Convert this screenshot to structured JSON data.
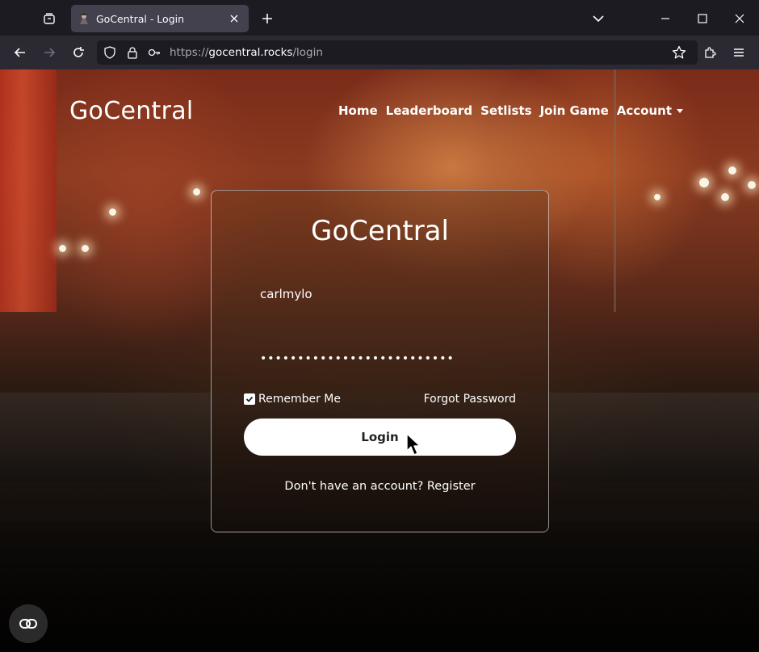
{
  "browser": {
    "tab": {
      "title": "GoCentral - Login",
      "favicon": "guitarist-favicon-icon"
    },
    "url": {
      "prefix": "https://",
      "host": "gocentral.rocks",
      "path": "/login"
    },
    "icons": {
      "tab_list": "tab-list-icon",
      "new_tab": "plus-icon",
      "list_all": "chevron-down-icon",
      "minimize": "minimize-icon",
      "maximize": "maximize-icon",
      "close": "close-icon",
      "back": "arrow-left-icon",
      "forward": "arrow-right-icon",
      "reload": "reload-icon",
      "shield": "shield-icon",
      "lock": "lock-icon",
      "key": "key-icon",
      "bookmark": "star-icon",
      "extensions": "puzzle-icon",
      "menu": "hamburger-icon"
    }
  },
  "header": {
    "brand": "GoCentral",
    "nav": [
      "Home",
      "Leaderboard",
      "Setlists",
      "Join Game",
      "Account"
    ]
  },
  "login": {
    "title": "GoCentral",
    "username": "carlmylo",
    "password_mask": "••••••••••••••••••••••••••",
    "remember_label": "Remember Me",
    "remember_checked": true,
    "forgot_label": "Forgot Password",
    "submit_label": "Login",
    "register_text": "Don't have an account? Register"
  },
  "floating_button": {
    "icon": "link-icon"
  },
  "colors": {
    "chrome_dark": "#1c1b22",
    "chrome_toolbar": "#2b2a33",
    "tab_active": "#42414d",
    "button_bg": "#ffffff"
  }
}
